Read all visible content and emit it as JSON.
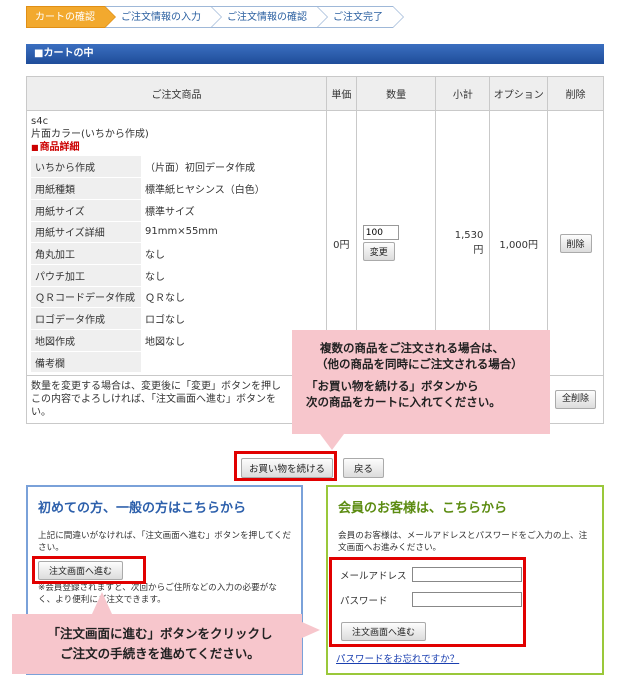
{
  "steps": [
    {
      "label": "カートの確認",
      "active": true
    },
    {
      "label": "ご注文情報の入力",
      "active": false
    },
    {
      "label": "ご注文情報の確認",
      "active": false
    },
    {
      "label": "ご注文完了",
      "active": false
    }
  ],
  "section_title": "■カートの中",
  "cart": {
    "headers": {
      "product": "ご注文商品",
      "unit_price": "単価",
      "quantity": "数量",
      "subtotal": "小計",
      "option": "オプション",
      "delete": "削除"
    },
    "item": {
      "code": "s4c",
      "name": "片面カラー(いちから作成)",
      "detail_label": "商品詳細",
      "details": [
        {
          "key": "いちから作成",
          "value": "（片面）初回データ作成"
        },
        {
          "key": "用紙種類",
          "value": "標準紙ヒヤシンス（白色）"
        },
        {
          "key": "用紙サイズ",
          "value": "標準サイズ"
        },
        {
          "key": "用紙サイズ詳細",
          "value": "91mm×55mm"
        },
        {
          "key": "角丸加工",
          "value": "なし"
        },
        {
          "key": "パウチ加工",
          "value": "なし"
        },
        {
          "key": "ＱＲコードデータ作成",
          "value": "ＱＲなし"
        },
        {
          "key": "ロゴデータ作成",
          "value": "ロゴなし"
        },
        {
          "key": "地図作成",
          "value": "地図なし"
        },
        {
          "key": "備考欄",
          "value": ""
        }
      ],
      "unit_price": "0円",
      "quantity_value": "100",
      "change_button": "変更",
      "subtotal": "1,530\n円",
      "option": "1,000円",
      "delete_button": "削除"
    },
    "note": "数量を変更する場合は、変更後に「変更」ボタンを押し\nこの内容でよろしければ、「注文画面へ進む」ボタンを\nい。",
    "delete_all_button": "全削除"
  },
  "callout_top": {
    "line1": "複数の商品をご注文される場合は、",
    "line2": "（他の商品を同時にご注文される場合）",
    "line3": "「お買い物を続ける」ボタンから",
    "line4": "次の商品をカートに入れてください。"
  },
  "continue_button": "お買い物を続ける",
  "back_button": "戻る",
  "guest_panel": {
    "title": "初めての方、一般の方はこちらから",
    "desc": "上記に間違いがなければ、「注文画面へ進む」ボタンを押してください。",
    "order_button": "注文画面へ進む",
    "note": "※会員登録されますと、次回からご住所などの入力の必要がなく、より便利にご注文できます。"
  },
  "member_panel": {
    "title": "会員のお客様は、こちらから",
    "desc": "会員のお客様は、メールアドレスとパスワードをご入力の上、注文画面へお進みください。",
    "email_label": "メールアドレス",
    "password_label": "パスワード",
    "order_button": "注文画面へ進む",
    "forgot_link": "パスワードをお忘れですか？"
  },
  "callout_bottom": {
    "line1": "「注文画面に進む」ボタンをクリックし",
    "line2": "ご注文の手続きを進めてください。"
  },
  "colors": {
    "step_active": "#f2a92e",
    "section_bar": "#1f4d9a",
    "highlight_red": "#e10000",
    "callout_pink": "#f7c6cc",
    "guest_border": "#7aa1d9",
    "member_border": "#9ac83a"
  }
}
